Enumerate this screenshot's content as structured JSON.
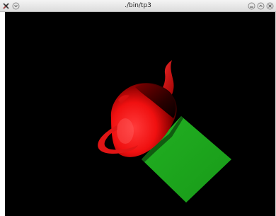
{
  "window": {
    "title": "./bin/tp3"
  },
  "icons": {
    "menu": "x-app-menu-icon",
    "shade": "window-shade-icon",
    "minimize": "minimize-icon",
    "maximize": "maximize-icon",
    "close": "close-icon"
  },
  "scene": {
    "background_color": "#000000",
    "teapot_color": "#ff1a1a",
    "cube_color": "#1faa1f"
  }
}
